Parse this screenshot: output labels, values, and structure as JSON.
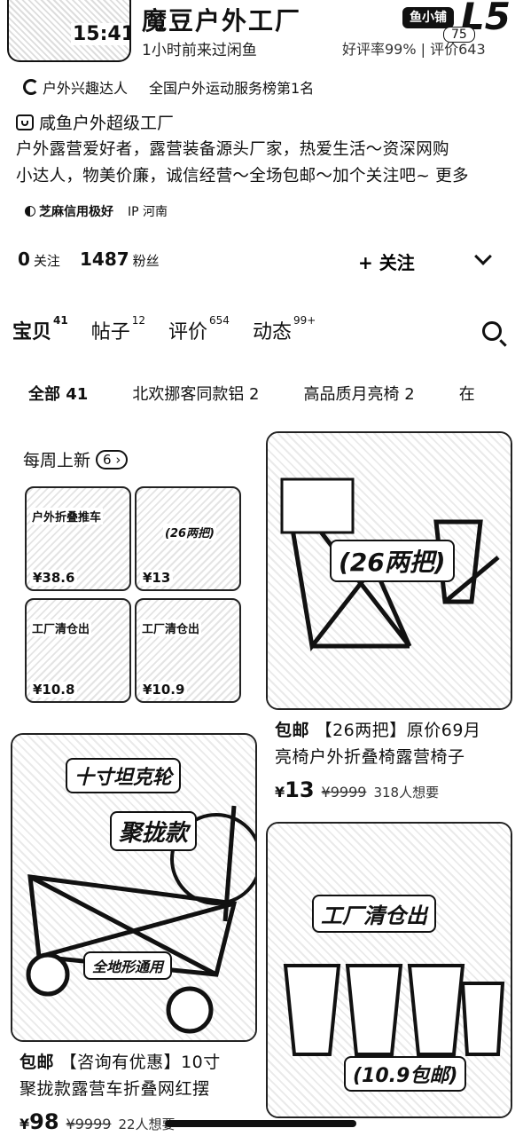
{
  "status_bar": {
    "time": "15:41"
  },
  "shop": {
    "name": "魔豆户外工厂",
    "last_seen": "1小时前来过闲鱼",
    "badge": "鱼小铺",
    "level": "L5",
    "level_num": "75",
    "rating": "好评率99% | 评价643"
  },
  "tags": [
    {
      "icon": "outdoor-icon",
      "label": "户外兴趣达人"
    },
    {
      "label": "全国户外运动服务榜第1名"
    }
  ],
  "store": {
    "icon": "store-icon",
    "label": "咸鱼户外超级工厂"
  },
  "bio": {
    "line1": "户外露营爱好者，露营装备源头厂家，热爱生活～资深网购",
    "line2": "小达人，物美价廉，诚信经营～全场包邮～加个关注吧~",
    "more": "更多"
  },
  "credit": {
    "sesame": "芝麻信用极好",
    "ip": "IP 河南"
  },
  "follow": {
    "following_count": "0",
    "following_label": "关注",
    "fans_count": "1487",
    "fans_label": "粉丝",
    "follow_button": "+ 关注"
  },
  "tabs": [
    {
      "label": "宝贝",
      "count": "41"
    },
    {
      "label": "帖子",
      "count": "12"
    },
    {
      "label": "评价",
      "count": "654"
    },
    {
      "label": "动态",
      "count": "99+"
    }
  ],
  "chips": [
    "全部 41",
    "北欢挪客同款铝 2",
    "高品质月亮椅 2",
    "在"
  ],
  "weekly": {
    "title": "每周上新",
    "count": "6",
    "items": [
      {
        "banner": "户外折叠推车",
        "price": "¥38.6"
      },
      {
        "banner": "(26两把)",
        "price": "¥13"
      },
      {
        "banner": "工厂清仓出",
        "price": "¥10.8"
      },
      {
        "banner": "工厂清仓出",
        "price": "¥10.9"
      }
    ]
  },
  "products": [
    {
      "overlay": "(26两把)",
      "desc_line1_tag": "包邮",
      "desc_line1": "【26两把】原价69月",
      "desc_line2": "亮椅户外折叠椅露营椅子",
      "price": "13",
      "currency": "¥",
      "old_price": "¥9999",
      "wants": "318人想要"
    },
    {
      "overlay_top": "十寸坦克轮",
      "overlay_mid": "聚拢款",
      "overlay_bottom": "全地形通用",
      "desc_line1_tag": "包邮",
      "desc_line1": "【咨询有优惠】10寸",
      "desc_line2": "聚拢款露营车折叠网红摆",
      "price": "98",
      "currency": "¥",
      "old_price": "¥9999",
      "wants": "22人想要"
    },
    {
      "overlay_top": "工厂清仓出",
      "overlay_bottom": "(10.9包邮)"
    }
  ]
}
